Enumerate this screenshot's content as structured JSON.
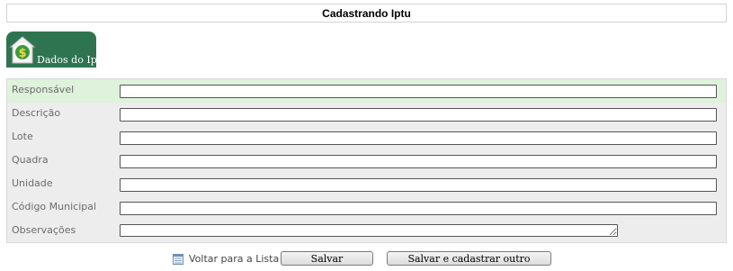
{
  "page": {
    "title": "Cadastrando Iptu"
  },
  "tab": {
    "label": "Dados do Iptu",
    "icon": "house-dollar-icon"
  },
  "form": {
    "fields": [
      {
        "label": "Responsável",
        "value": ""
      },
      {
        "label": "Descrição",
        "value": ""
      },
      {
        "label": "Lote",
        "value": ""
      },
      {
        "label": "Quadra",
        "value": ""
      },
      {
        "label": "Unidade",
        "value": ""
      },
      {
        "label": "Código Municipal",
        "value": ""
      },
      {
        "label": "Observações",
        "value": ""
      }
    ]
  },
  "footer": {
    "back_label": "Voltar para a Lista",
    "back_icon": "list-icon",
    "save_label": "Salvar",
    "save_new_label": "Salvar e cadastrar outro"
  },
  "colors": {
    "tab_bg": "#2e7450",
    "highlight_row": "#dff2dc",
    "panel_bg": "#ededed"
  }
}
